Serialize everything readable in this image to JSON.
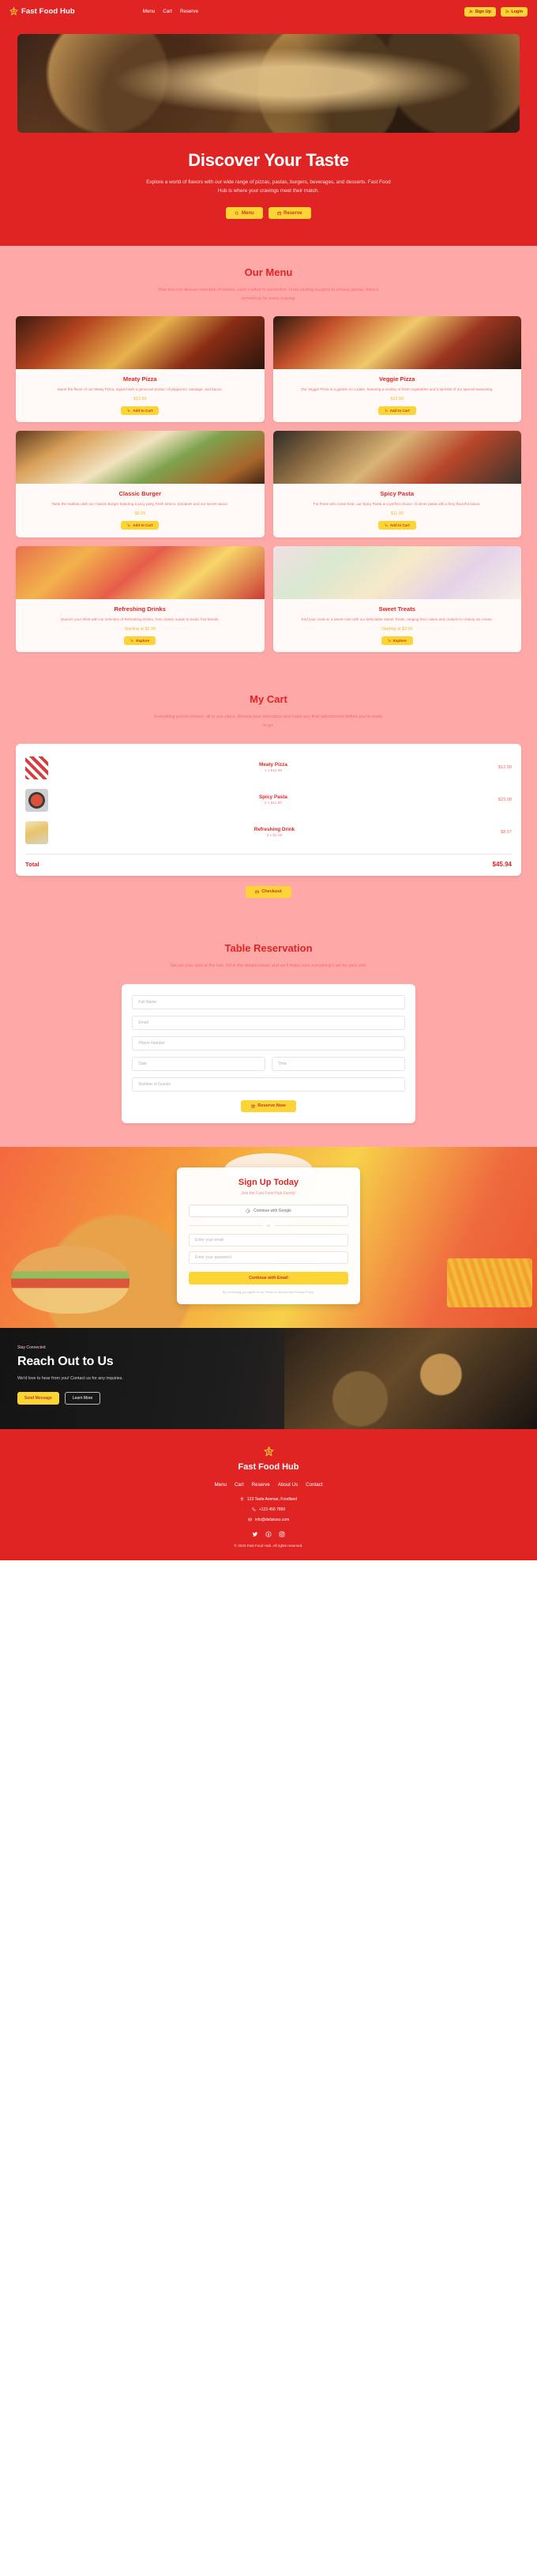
{
  "brand": {
    "name": "Fast Food Hub",
    "logo_icon": "lightning-star-icon",
    "accent": "#e02424",
    "yellow": "#fcd535",
    "pink": "#ffa8a8"
  },
  "header": {
    "nav": [
      {
        "label": "Menu",
        "name": "nav-link-menu"
      },
      {
        "label": "Cart",
        "name": "nav-link-cart"
      },
      {
        "label": "Reserve",
        "name": "nav-link-reserve"
      }
    ],
    "signup_label": "Sign Up",
    "login_label": "Login",
    "signup_icon": "user-plus-icon",
    "login_icon": "login-icon"
  },
  "hero": {
    "title": "Discover Your Taste",
    "subtitle": "Explore a world of flavors with our wide range of pizzas, pastas, burgers, beverages, and desserts. Fast Food Hub is where your cravings meet their match.",
    "menu_btn": "Menu",
    "menu_btn_icon": "search-icon",
    "reserve_btn": "Reserve",
    "reserve_btn_icon": "calendar-icon"
  },
  "menu": {
    "title": "Our Menu",
    "subtitle": "Dive into our diverse selection of dishes, each crafted to perfection. From sizzling burgers to cheesy pizzas, there's something for every craving.",
    "items": [
      {
        "name": "Meaty Pizza",
        "desc": "Savor the flavor of our Meaty Pizza, topped with a generous portion of pepperoni, sausage, and bacon.",
        "price": "$12.99",
        "button": "Add to Cart",
        "button_icon": "cart-plus-icon",
        "img_class": "m1"
      },
      {
        "name": "Veggie Pizza",
        "desc": "Our Veggie Pizza is a garden on a plate, featuring a medley of fresh vegetables and a sprinkle of our special seasoning.",
        "price": "$10.99",
        "button": "Add to Cart",
        "button_icon": "cart-plus-icon",
        "img_class": "m2"
      },
      {
        "name": "Classic Burger",
        "desc": "Taste the tradition with our Classic Burger featuring a juicy patty, fresh lettuce, tomatoes and our secret sauce.",
        "price": "$8.99",
        "button": "Add to Cart",
        "button_icon": "cart-plus-icon",
        "img_class": "m3"
      },
      {
        "name": "Spicy Pasta",
        "desc": "For those who crave heat, our Spicy Pasta is a perfect choice. Al dente pasta with a fiery flavorful sauce.",
        "price": "$11.99",
        "button": "Add to Cart",
        "button_icon": "cart-plus-icon",
        "img_class": "m4"
      },
      {
        "name": "Refreshing Drinks",
        "desc": "Quench your thirst with our selection of Refreshing Drinks, from classic sodas to exotic fruit blends.",
        "price": "Starting at $2.99",
        "button": "Explore",
        "button_icon": "cup-icon",
        "img_class": "m5"
      },
      {
        "name": "Sweet Treats",
        "desc": "End your meal on a sweet note with our delectable Sweet Treats, ranging from cakes and cookies to creamy ice cream.",
        "price": "Starting at $3.99",
        "button": "Explore",
        "button_icon": "cake-icon",
        "img_class": "m6"
      }
    ]
  },
  "cart": {
    "title": "My Cart",
    "subtitle": "Everything you've chosen, all in one place. Review your selections and make any final adjustments before you're ready to go.",
    "rows": [
      {
        "name": "Meaty Pizza",
        "qty": "1 x $12.99",
        "price": "$12.99",
        "thumb_class": "c1"
      },
      {
        "name": "Spicy Pasta",
        "qty": "2 x $11.99",
        "price": "$23.98",
        "thumb_class": "c2"
      },
      {
        "name": "Refreshing Drink",
        "qty": "3 x $2.99",
        "price": "$8.97",
        "thumb_class": "c3"
      }
    ],
    "total_label": "Total",
    "total_value": "$45.94",
    "checkout_label": "Checkout",
    "checkout_icon": "credit-card-icon"
  },
  "reservation": {
    "title": "Table Reservation",
    "subtitle": "Secure your spot at the hub. Fill in the details below, and we'll make sure everything's set for your visit.",
    "fields": [
      {
        "placeholder": "Full Name",
        "name": "full-name-field"
      },
      {
        "placeholder": "Email",
        "name": "email-field"
      }
    ],
    "phone_placeholder": "Phone Number",
    "date_placeholder": "Date",
    "time_placeholder": "Time",
    "guests_placeholder": "Number of Guests",
    "submit_label": "Reserve Now",
    "submit_icon": "calendar-check-icon"
  },
  "signup": {
    "title": "Sign Up Today",
    "subtitle": "Join the Fast Food Hub Family!",
    "google_label": "Continue with Google",
    "google_icon": "google-icon",
    "divider": "or",
    "email_placeholder": "Enter your email",
    "password_placeholder": "Enter your password",
    "submit_label": "Continue with Email",
    "legal": "By continuing you agree to our Terms of Service and Privacy Policy."
  },
  "contact": {
    "eyebrow": "Stay Connected",
    "title": "Reach Out to Us",
    "text": "We'd love to hear from you! Contact us for any inquiries.",
    "send_label": "Send Message",
    "learn_label": "Learn More"
  },
  "footer": {
    "brand": "Fast Food Hub",
    "links": [
      "Menu",
      "Cart",
      "Reserve",
      "About Us",
      "Contact"
    ],
    "address": "123 Taste Avenue, Foodland",
    "address_icon": "location-pin-icon",
    "phone": "+123 456 7890",
    "phone_icon": "phone-icon",
    "email": "info@delizioso.com",
    "email_icon": "envelope-icon",
    "socials": [
      "twitter-icon",
      "facebook-icon",
      "instagram-icon"
    ],
    "copyright": "© 2023 Fast Food Hub. All rights reserved."
  }
}
